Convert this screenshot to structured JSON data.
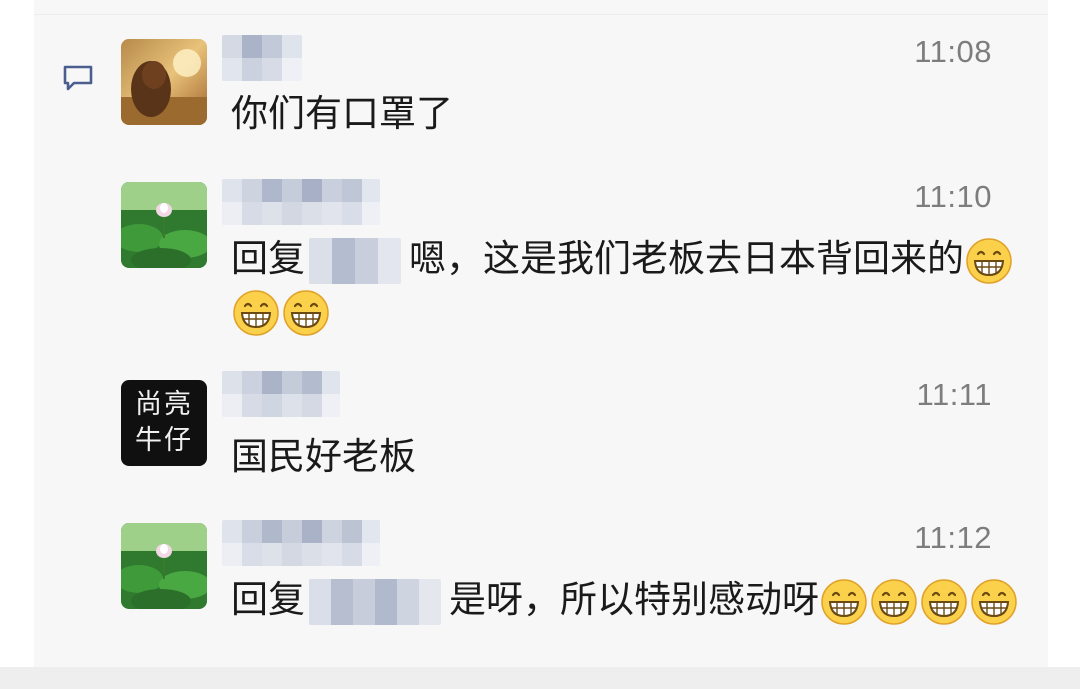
{
  "comments": [
    {
      "time": "11:08",
      "text": "你们有口罩了"
    },
    {
      "time": "11:10",
      "reply_prefix": "回复",
      "text": "嗯，这是我们老板去日本背回来的"
    },
    {
      "time": "11:11",
      "avatar_text": [
        "尚亮",
        "牛仔"
      ],
      "text": "国民好老板"
    },
    {
      "time": "11:12",
      "reply_prefix": "回复",
      "text": "是呀，所以特别感动呀"
    }
  ],
  "emoji_icon": "grinning-face",
  "comment_icon": "comment-bubble",
  "colors": {
    "panel_bg": "#f7f7f7",
    "time_text": "#7d7d7d",
    "message_text": "#1a1a1a",
    "comment_icon": "#4a5f8f"
  }
}
